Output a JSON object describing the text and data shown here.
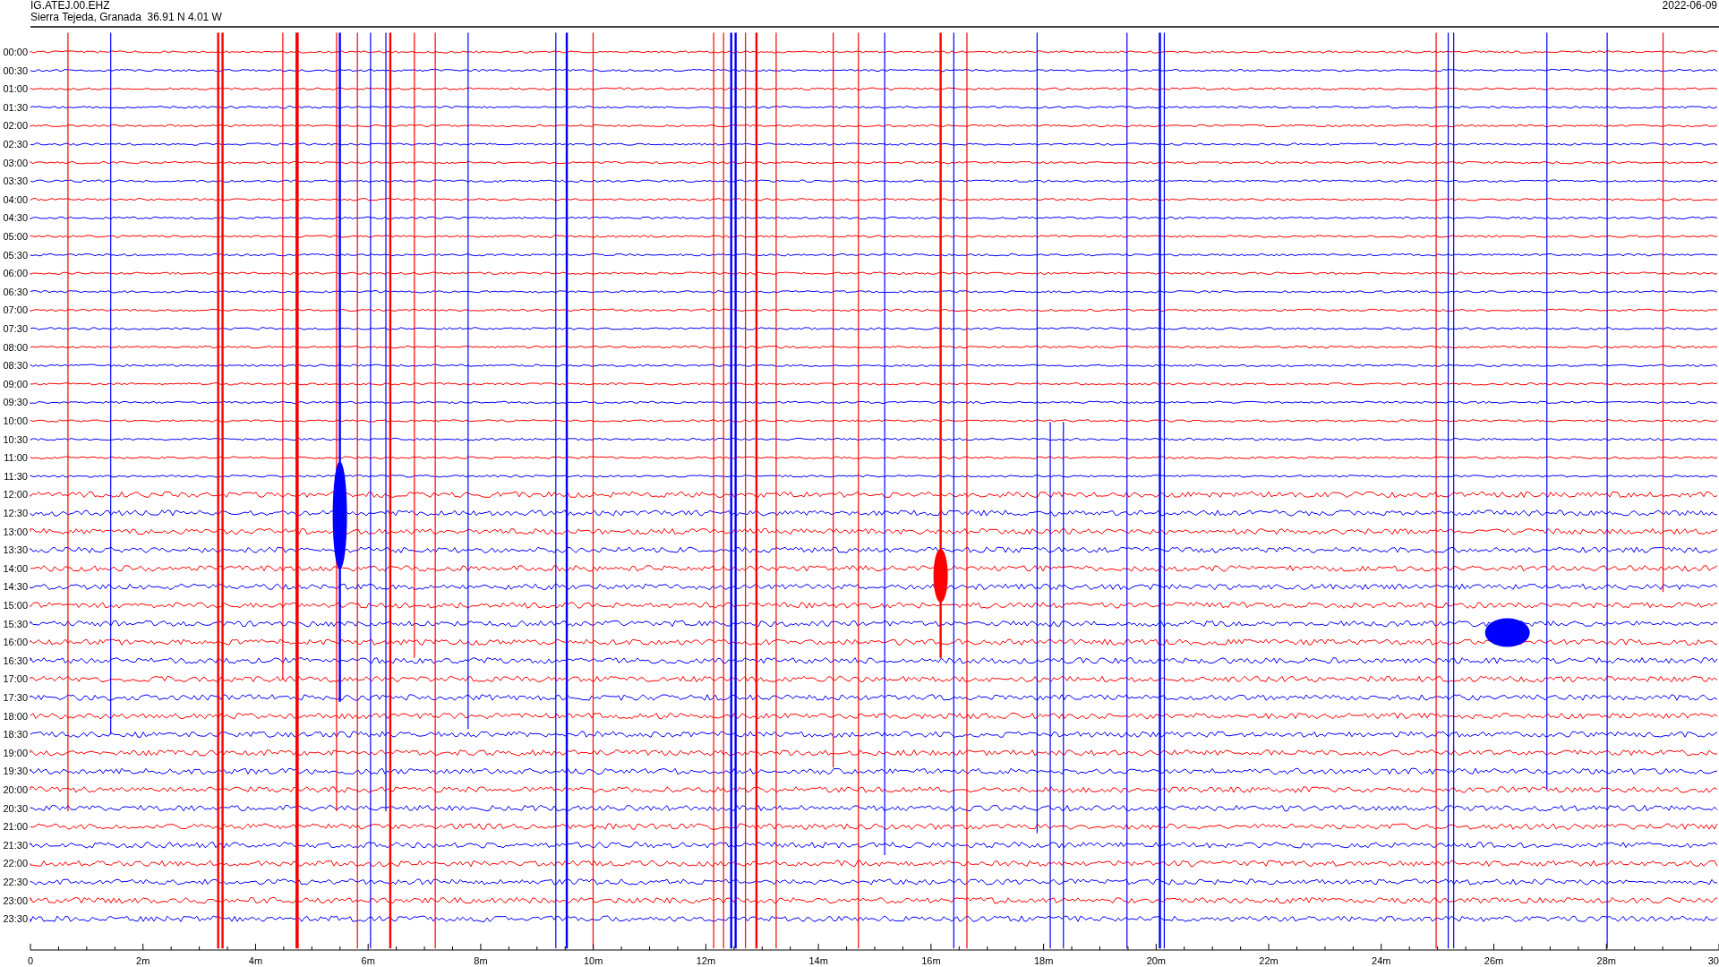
{
  "header": {
    "station": "IG.ATEJ.00.EHZ",
    "location": "Sierra Tejeda, Granada  36.91 N 4.01 W",
    "date": "2022-06-09"
  },
  "rows": [
    {
      "label": "00:00",
      "color": "#ff0000"
    },
    {
      "label": "00:30",
      "color": "#0000ff"
    },
    {
      "label": "01:00",
      "color": "#ff0000"
    },
    {
      "label": "01:30",
      "color": "#0000ff"
    },
    {
      "label": "02:00",
      "color": "#ff0000"
    },
    {
      "label": "02:30",
      "color": "#0000ff"
    },
    {
      "label": "03:00",
      "color": "#ff0000"
    },
    {
      "label": "03:30",
      "color": "#0000ff"
    },
    {
      "label": "04:00",
      "color": "#ff0000"
    },
    {
      "label": "04:30",
      "color": "#0000ff"
    },
    {
      "label": "05:00",
      "color": "#ff0000"
    },
    {
      "label": "05:30",
      "color": "#0000ff"
    },
    {
      "label": "06:00",
      "color": "#ff0000"
    },
    {
      "label": "06:30",
      "color": "#0000ff"
    },
    {
      "label": "07:00",
      "color": "#ff0000"
    },
    {
      "label": "07:30",
      "color": "#0000ff"
    },
    {
      "label": "08:00",
      "color": "#ff0000"
    },
    {
      "label": "08:30",
      "color": "#0000ff"
    },
    {
      "label": "09:00",
      "color": "#ff0000"
    },
    {
      "label": "09:30",
      "color": "#0000ff"
    },
    {
      "label": "10:00",
      "color": "#ff0000"
    },
    {
      "label": "10:30",
      "color": "#0000ff"
    },
    {
      "label": "11:00",
      "color": "#ff0000"
    },
    {
      "label": "11:30",
      "color": "#0000ff"
    },
    {
      "label": "12:00",
      "color": "#ff0000"
    },
    {
      "label": "12:30",
      "color": "#0000ff"
    },
    {
      "label": "13:00",
      "color": "#ff0000"
    },
    {
      "label": "13:30",
      "color": "#0000ff"
    },
    {
      "label": "14:00",
      "color": "#ff0000"
    },
    {
      "label": "14:30",
      "color": "#0000ff"
    },
    {
      "label": "15:00",
      "color": "#ff0000"
    },
    {
      "label": "15:30",
      "color": "#0000ff"
    },
    {
      "label": "16:00",
      "color": "#ff0000"
    },
    {
      "label": "16:30",
      "color": "#0000ff"
    },
    {
      "label": "17:00",
      "color": "#ff0000"
    },
    {
      "label": "17:30",
      "color": "#0000ff"
    },
    {
      "label": "18:00",
      "color": "#ff0000"
    },
    {
      "label": "18:30",
      "color": "#0000ff"
    },
    {
      "label": "19:00",
      "color": "#ff0000"
    },
    {
      "label": "19:30",
      "color": "#0000ff"
    },
    {
      "label": "20:00",
      "color": "#ff0000"
    },
    {
      "label": "20:30",
      "color": "#0000ff"
    },
    {
      "label": "21:00",
      "color": "#ff0000"
    },
    {
      "label": "21:30",
      "color": "#0000ff"
    },
    {
      "label": "22:00",
      "color": "#ff0000"
    },
    {
      "label": "22:30",
      "color": "#0000ff"
    },
    {
      "label": "23:00",
      "color": "#ff0000"
    },
    {
      "label": "23:30",
      "color": "#0000ff"
    }
  ],
  "x_axis": {
    "ticks": [
      "0",
      "2m",
      "4m",
      "6m",
      "8m",
      "10m",
      "12m",
      "14m",
      "16m",
      "18m",
      "20m",
      "22m",
      "24m",
      "26m",
      "28m",
      "30"
    ]
  }
}
